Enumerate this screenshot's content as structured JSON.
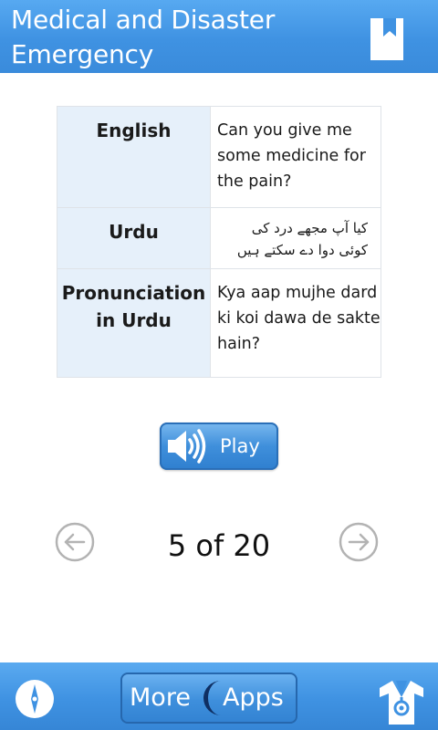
{
  "header": {
    "title_line1": "Medical and Disaster",
    "title_line2": "Emergency",
    "bookmark_icon": "bookmark-icon"
  },
  "phrase": {
    "rows": [
      {
        "label": "English",
        "value": "Can you give me some medicine for the pain?"
      },
      {
        "label": "Urdu",
        "value": "کیا آپ مجھے درد کی کوئی دوا دے سکتے ہیں"
      },
      {
        "label_line1": "Pronunciation",
        "label_line2": "in Urdu",
        "value": "Kya aap mujhe dard ki koi dawa de sakte  hain?"
      }
    ]
  },
  "player": {
    "play_label": "Play",
    "icon": "speaker-icon"
  },
  "pager": {
    "current": 5,
    "total": 20,
    "text": "5 of 20",
    "prev_icon": "arrow-left-icon",
    "next_icon": "arrow-right-icon"
  },
  "bottom_bar": {
    "more_label": "More",
    "apps_label": "Apps",
    "left_icon": "compass-icon",
    "right_icon": "doctor-icon"
  },
  "colors": {
    "header_blue": "#3f92e2",
    "label_cell_bg": "#e6f0fa",
    "button_blue": "#3f8fdb"
  }
}
